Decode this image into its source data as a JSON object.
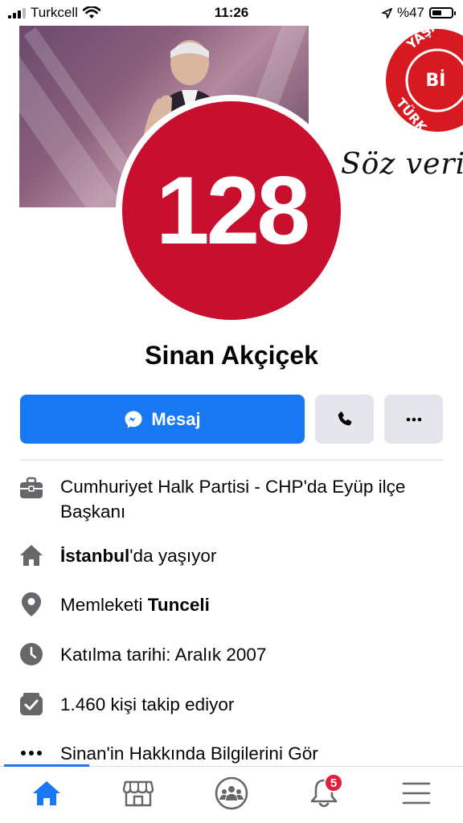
{
  "status_bar": {
    "carrier": "Turkcell",
    "time": "11:26",
    "battery": "%47"
  },
  "profile": {
    "badge_number": "128",
    "name": "Sinan Akçiçek",
    "cover_seal_text": "YAŞANABİLİR TÜRKİYE",
    "cover_signature": "Söz veriyoruz"
  },
  "actions": {
    "message_label": "Mesaj",
    "message_icon": "messenger-icon",
    "call_icon": "phone-icon",
    "more_icon": "more-horizontal-icon"
  },
  "info": [
    {
      "icon": "briefcase-icon",
      "text": "Cumhuriyet Halk Partisi - CHP'da Eyüp ilçe Başkanı"
    },
    {
      "icon": "home-icon",
      "bold": "İstanbul",
      "text": "'da yaşıyor"
    },
    {
      "icon": "location-pin-icon",
      "text": "Memleketi ",
      "bold": "Tunceli"
    },
    {
      "icon": "clock-icon",
      "text": "Katılma tarihi: Aralık 2007"
    },
    {
      "icon": "followers-icon",
      "text": "1.460 kişi takip ediyor"
    },
    {
      "icon": "ellipsis-icon",
      "text": "Sinan'in Hakkında Bilgilerini Gör"
    }
  ],
  "tabbar": {
    "notifications_count": "5",
    "tabs": [
      "home-icon",
      "marketplace-icon",
      "groups-icon",
      "notifications-icon",
      "menu-icon"
    ]
  },
  "colors": {
    "accent": "#1877f2",
    "badge_red": "#c8102e",
    "notification_red": "#e41e3f"
  }
}
